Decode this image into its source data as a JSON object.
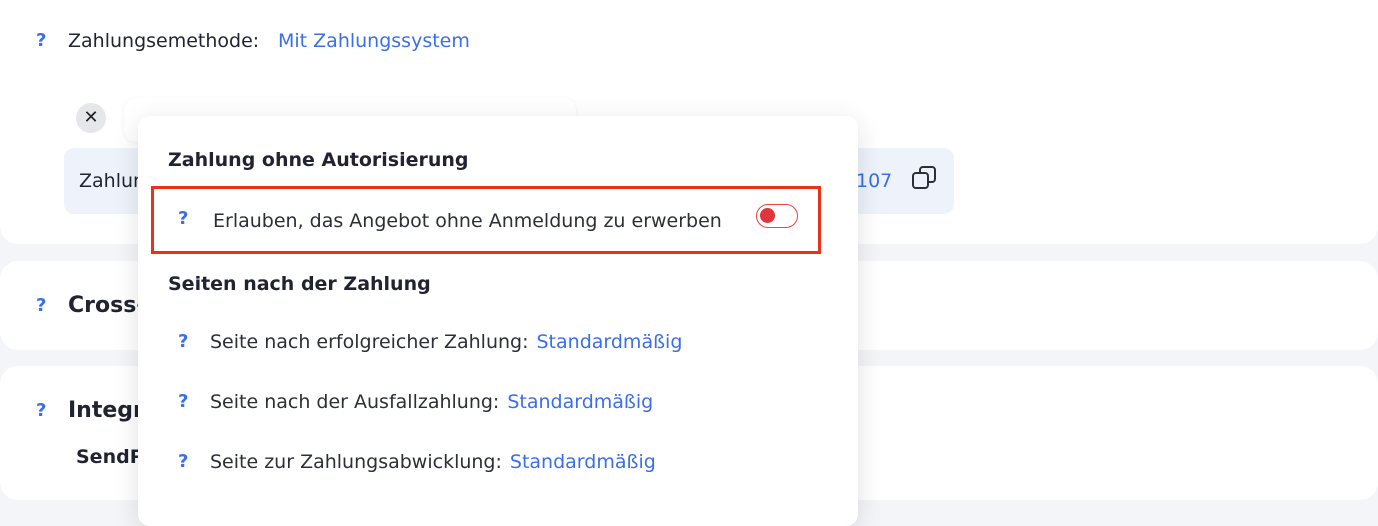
{
  "payment": {
    "help": "?",
    "method_label": "Zahlungsemethode:",
    "method_value": "Mit Zahlungssystem",
    "remove_symbol": "✕",
    "id_label": "Zahlur",
    "id_value": "107"
  },
  "cross_section": {
    "help": "?",
    "title": "Cross-"
  },
  "integration_section": {
    "help": "?",
    "title": "Integr",
    "subtitle": "SendP"
  },
  "popup": {
    "heading_no_auth": "Zahlung ohne Autorisierung",
    "allow_help": "?",
    "allow_label": "Erlauben, das Angebot ohne Anmeldung zu erwerben",
    "allow_toggle_on": false,
    "heading_after_pay": "Seiten nach der Zahlung",
    "pages": [
      {
        "help": "?",
        "label": "Seite nach erfolgreicher Zahlung:",
        "value": "Standardmäßig"
      },
      {
        "help": "?",
        "label": "Seite nach der Ausfallzahlung:",
        "value": "Standardmäßig"
      },
      {
        "help": "?",
        "label": "Seite zur Zahlungsabwicklung:",
        "value": "Standardmäßig"
      }
    ]
  },
  "colors": {
    "accent": "#3a6fe8",
    "highlight_border": "#e8321c",
    "toggle_off": "#e0363a"
  },
  "icons": {
    "copy": "copy-icon",
    "close": "close-icon",
    "help": "help-icon"
  }
}
